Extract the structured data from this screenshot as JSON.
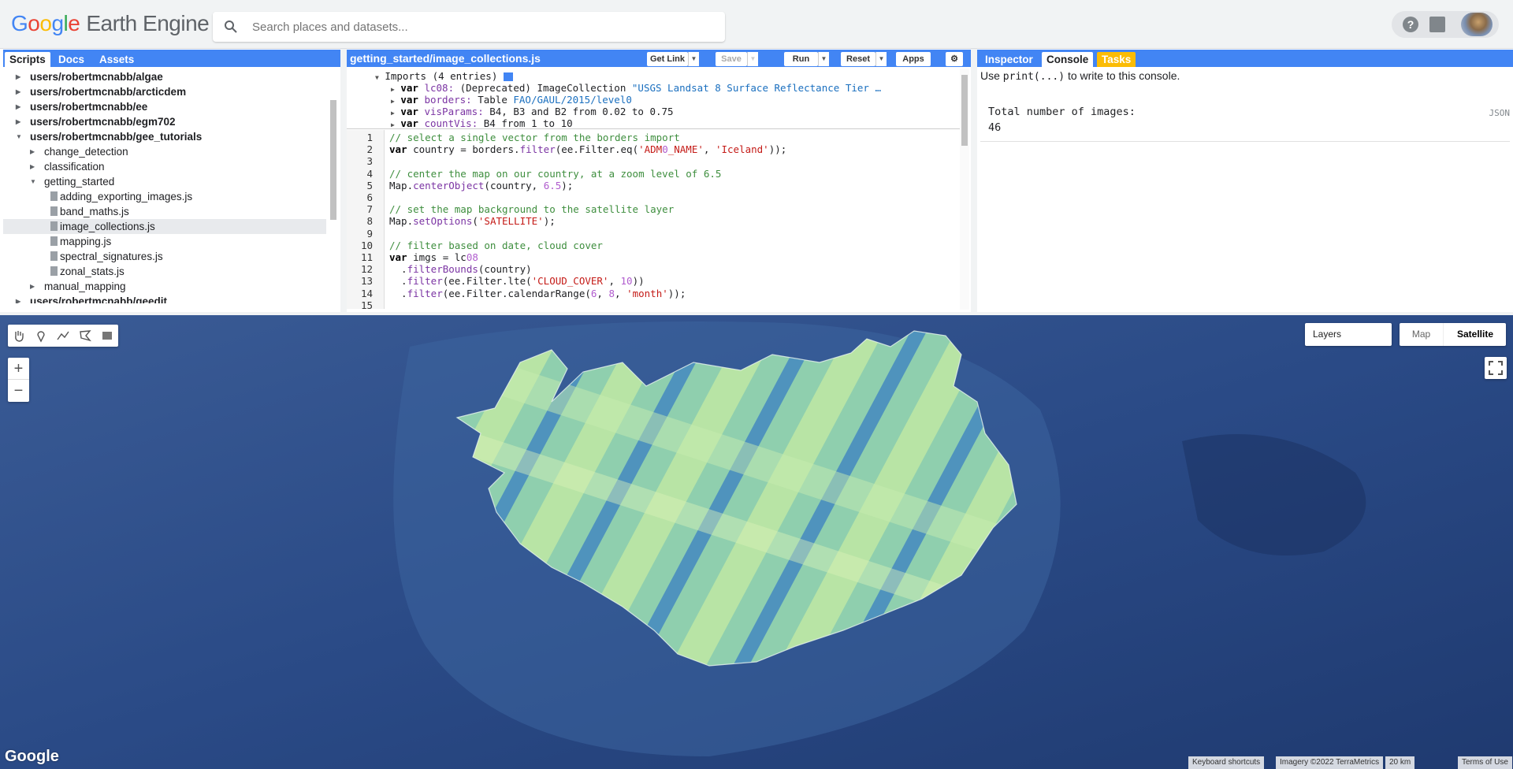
{
  "app": {
    "logo_google": [
      "G",
      "o",
      "o",
      "g",
      "l",
      "e"
    ],
    "logo_product": "Earth Engine",
    "search_placeholder": "Search places and datasets..."
  },
  "left_panel": {
    "tabs": [
      "Scripts",
      "Docs",
      "Assets"
    ],
    "active_tab": "Scripts",
    "tree": [
      {
        "label": "users/robertmcnabb/algae",
        "level": 0,
        "type": "folder",
        "bold": true,
        "expanded": false
      },
      {
        "label": "users/robertmcnabb/arcticdem",
        "level": 0,
        "type": "folder",
        "bold": true,
        "expanded": false
      },
      {
        "label": "users/robertmcnabb/ee",
        "level": 0,
        "type": "folder",
        "bold": true,
        "expanded": false
      },
      {
        "label": "users/robertmcnabb/egm702",
        "level": 0,
        "type": "folder",
        "bold": true,
        "expanded": false
      },
      {
        "label": "users/robertmcnabb/gee_tutorials",
        "level": 0,
        "type": "folder",
        "bold": true,
        "expanded": true
      },
      {
        "label": "change_detection",
        "level": 1,
        "type": "folder",
        "bold": false,
        "expanded": false
      },
      {
        "label": "classification",
        "level": 1,
        "type": "folder",
        "bold": false,
        "expanded": false
      },
      {
        "label": "getting_started",
        "level": 1,
        "type": "folder",
        "bold": false,
        "expanded": true
      },
      {
        "label": "adding_exporting_images.js",
        "level": 2,
        "type": "file"
      },
      {
        "label": "band_maths.js",
        "level": 2,
        "type": "file"
      },
      {
        "label": "image_collections.js",
        "level": 2,
        "type": "file",
        "selected": true
      },
      {
        "label": "mapping.js",
        "level": 2,
        "type": "file"
      },
      {
        "label": "spectral_signatures.js",
        "level": 2,
        "type": "file"
      },
      {
        "label": "zonal_stats.js",
        "level": 2,
        "type": "file"
      },
      {
        "label": "manual_mapping",
        "level": 1,
        "type": "folder",
        "bold": false,
        "expanded": false
      },
      {
        "label": "users/robertmcnabb/geedit",
        "level": 0,
        "type": "folder",
        "bold": true,
        "expanded": false
      }
    ]
  },
  "editor": {
    "title": "getting_started/image_collections.js",
    "buttons": {
      "get_link": "Get Link",
      "save": "Save",
      "run": "Run",
      "reset": "Reset",
      "apps": "Apps"
    },
    "imports_header": "Imports (4 entries)",
    "imports": [
      {
        "name": "lc08",
        "text": " (Deprecated) ImageCollection ",
        "value": "\"USGS Landsat 8 Surface Reflectance Tier …"
      },
      {
        "name": "borders",
        "text": " Table ",
        "value": "FAO/GAUL/2015/level0"
      },
      {
        "name": "visParams",
        "text": " B4, B3 and B2 from 0.02 to 0.75",
        "value": ""
      },
      {
        "name": "countVis",
        "text": " B4 from 1 to 10",
        "value": ""
      }
    ],
    "line_numbers": [
      "1",
      "2",
      "3",
      "4",
      "5",
      "6",
      "7",
      "8",
      "9",
      "10",
      "11",
      "12",
      "13",
      "14",
      "15"
    ],
    "code_lines": [
      "// select a single vector from the borders import",
      "var country = borders.filter(ee.Filter.eq('ADM0_NAME', 'Iceland'));",
      "",
      "// center the map on our country, at a zoom level of 6.5",
      "Map.centerObject(country, 6.5);",
      "",
      "// set the map background to the satellite layer",
      "Map.setOptions('SATELLITE');",
      "",
      "// filter based on date, cloud cover",
      "var imgs = lc08",
      "  .filterBounds(country)",
      "  .filter(ee.Filter.lte('CLOUD_COVER', 10))",
      "  .filter(ee.Filter.calendarRange(6, 8, 'month'));",
      ""
    ]
  },
  "right_panel": {
    "tabs": [
      "Inspector",
      "Console",
      "Tasks"
    ],
    "active_tab": "Console",
    "hint_pre": "Use ",
    "hint_code": "print(...)",
    "hint_post": " to write to this console.",
    "output_label": "Total number of images:",
    "output_value": "46",
    "json_label": "JSON"
  },
  "map": {
    "layers_label": "Layers",
    "map_type_map": "Map",
    "map_type_satellite": "Satellite",
    "zoom_in": "+",
    "zoom_out": "−",
    "google_logo": "Google",
    "attribution": {
      "shortcuts": "Keyboard shortcuts",
      "imagery": "Imagery ©2022 TerraMetrics",
      "scale": "20 km",
      "terms": "Terms of Use"
    },
    "colors": {
      "ocean": "#2c4a82",
      "land_light": "#b6e3a3",
      "land_mid": "#7fc6a8",
      "land_dark": "#3f86b6"
    }
  }
}
